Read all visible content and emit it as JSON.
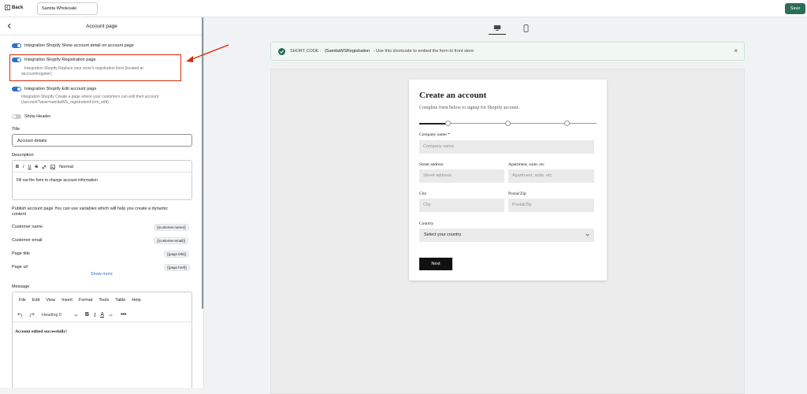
{
  "topbar": {
    "back_label": "Back",
    "store_name": "Samita Wholesale",
    "save_label": "Save"
  },
  "panel": {
    "title": "Account page",
    "toggles": [
      {
        "label": "Integration Shopify Show account detail on account page",
        "on": true
      },
      {
        "label": "Integration Shopify Registration page",
        "desc_line1": "Integration Shopify Replace your store's registration form (located at",
        "desc_line2": "/account/register)",
        "on": true
      },
      {
        "label": "Integration Shopify Edit account page",
        "desc_line1": "Integration Shopify Create a page where your customers can edit their account",
        "desc_line2": "(/account?view=samitaWS_registrationForm_edit)",
        "on": true
      },
      {
        "label": "Show Header",
        "on": false
      }
    ],
    "title_label": "Title",
    "title_value": "Account details",
    "description_label": "Description",
    "description_toolbar": [
      "B",
      "I",
      "U",
      "S",
      "link-icon",
      "image-icon",
      "Normal"
    ],
    "description_value": "Fill out the form to change account information",
    "publish_text_line1": "Publish account page You can use variables which will help you create a dynamic",
    "publish_text_line2": "content",
    "variables": [
      {
        "label": "Customer name",
        "token": "{{customer.name}}"
      },
      {
        "label": "Customer email",
        "token": "{{customer.email}}"
      },
      {
        "label": "Page title",
        "token": "{{page.title}}"
      },
      {
        "label": "Page url",
        "token": "{{page.href}}"
      }
    ],
    "show_more": "Show more",
    "message_label": "Message",
    "menu": [
      "File",
      "Edit",
      "View",
      "Insert",
      "Format",
      "Tools",
      "Table",
      "Help"
    ],
    "heading_select": "Heading 5",
    "message_content": "Account edited successfully!"
  },
  "shortcode": {
    "prefix": "SHORT CODE :",
    "code": "{SamitaWSRegistration",
    "hint": "- Use this shortcode to embed the form to front store"
  },
  "form": {
    "title": "Create an account",
    "subtitle": "Complete form below to signup for Shopify account.",
    "company_label": "Company name *",
    "company_placeholder": "Company name",
    "street_label": "Street address",
    "street_placeholder": "Street address",
    "apt_label": "Apartment, suite, etc",
    "apt_placeholder": "Apartment, suite, etc",
    "city_label": "City",
    "city_placeholder": "City",
    "zip_label": "Postal/Zip",
    "zip_placeholder": "Postal/Zip",
    "country_label": "Country",
    "country_value": "Select your country",
    "next_label": "Next"
  },
  "colors": {
    "primary": "#2a6e58",
    "toggle": "#2c6ecb",
    "highlight": "#d82c0d"
  }
}
